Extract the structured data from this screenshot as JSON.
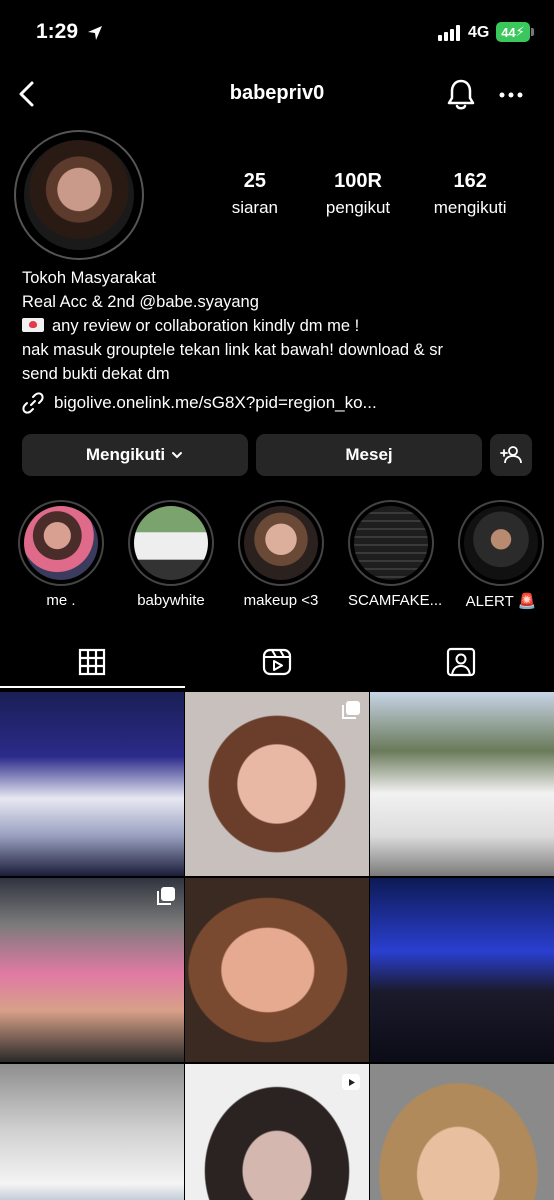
{
  "status": {
    "time": "1:29",
    "network": "4G",
    "battery": "44"
  },
  "nav": {
    "username": "babepriv0"
  },
  "profile": {
    "stats": [
      {
        "value": "25",
        "label": "siaran"
      },
      {
        "value": "100R",
        "label": "pengikut"
      },
      {
        "value": "162",
        "label": "mengikuti"
      }
    ],
    "bio": {
      "line1": "Tokoh Masyarakat",
      "line2": "Real Acc & 2nd @babe.syayang",
      "line3": "any review or collaboration kindly dm me !",
      "line4": "nak masuk grouptele tekan link kat bawah! download & sr",
      "line5": "send bukti dekat dm"
    },
    "link": "bigolive.onelink.me/sG8X?pid=region_ko..."
  },
  "buttons": {
    "follow": "Mengikuti",
    "message": "Mesej"
  },
  "highlights": [
    {
      "label": "me ."
    },
    {
      "label": "babywhite"
    },
    {
      "label": "makeup <3"
    },
    {
      "label": "SCAMFAKE..."
    },
    {
      "label": "ALERT 🚨"
    }
  ],
  "colors": {
    "background": "#000000",
    "button": "#262626",
    "battery": "#3ac85c"
  },
  "grid": {
    "posts": [
      {
        "badge": "none"
      },
      {
        "badge": "carousel"
      },
      {
        "badge": "none"
      },
      {
        "badge": "carousel"
      },
      {
        "badge": "none"
      },
      {
        "badge": "none"
      },
      {
        "badge": "none"
      },
      {
        "badge": "reel"
      },
      {
        "badge": "none"
      }
    ]
  }
}
